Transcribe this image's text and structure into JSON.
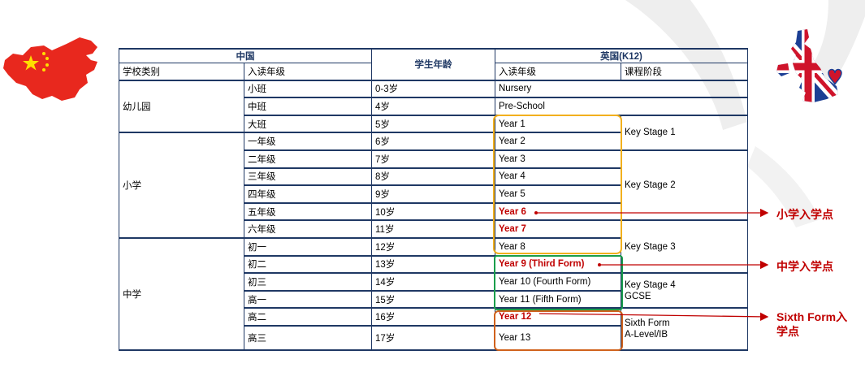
{
  "table": {
    "header": {
      "china": "中国",
      "age": "学生年龄",
      "uk": "英国(K12)"
    },
    "subheader": {
      "school_type": "学校类别",
      "grade": "入读年级",
      "uk_grade": "入读年级",
      "stage": "课程阶段"
    },
    "groups": {
      "kindergarten": "幼儿园",
      "primary": "小学",
      "middle": "中学"
    },
    "rows": [
      {
        "cn_grade": "小班",
        "age": "0-3岁",
        "uk": "Nursery"
      },
      {
        "cn_grade": "中班",
        "age": "4岁",
        "uk": "Pre-School"
      },
      {
        "cn_grade": "大班",
        "age": "5岁",
        "uk": "Year 1"
      },
      {
        "cn_grade": "一年级",
        "age": "6岁",
        "uk": "Year 2"
      },
      {
        "cn_grade": "二年级",
        "age": "7岁",
        "uk": "Year 3"
      },
      {
        "cn_grade": "三年级",
        "age": "8岁",
        "uk": "Year 4"
      },
      {
        "cn_grade": "四年级",
        "age": "9岁",
        "uk": "Year 5"
      },
      {
        "cn_grade": "五年级",
        "age": "10岁",
        "uk": "Year 6"
      },
      {
        "cn_grade": "六年级",
        "age": "11岁",
        "uk": "Year 7"
      },
      {
        "cn_grade": "初一",
        "age": "12岁",
        "uk": "Year 8"
      },
      {
        "cn_grade": "初二",
        "age": "13岁",
        "uk": "Year 9 (Third Form)"
      },
      {
        "cn_grade": "初三",
        "age": "14岁",
        "uk": "Year 10 (Fourth Form)"
      },
      {
        "cn_grade": "高一",
        "age": "15岁",
        "uk": "Year 11 (Fifth Form)"
      },
      {
        "cn_grade": "高二",
        "age": "16岁",
        "uk": "Year 12"
      },
      {
        "cn_grade": "高三",
        "age": "17岁",
        "uk": "Year 13"
      }
    ],
    "stages": {
      "ks1": "Key Stage 1",
      "ks2": "Key Stage 2",
      "ks3": "Key Stage 3",
      "ks4_line1": "Key Stage 4",
      "ks4_line2": "GCSE",
      "sixth_line1": "Sixth Form",
      "sixth_line2": "A-Level/IB"
    }
  },
  "annotations": {
    "primary_entry": "小学入学点",
    "middle_entry": "中学入学点",
    "sixth_entry_line1": "Sixth Form入",
    "sixth_entry_line2": "学点"
  },
  "colors": {
    "border": "#1f3864",
    "highlight_red": "#c00000",
    "box_yellow": "#f2b01e",
    "box_green": "#1a9e4b",
    "box_orange": "#d0621c",
    "china_red": "#e8281e",
    "china_star": "#ffde00"
  },
  "icons": [
    "china-map-flag-icon",
    "uk-map-flag-icon"
  ]
}
